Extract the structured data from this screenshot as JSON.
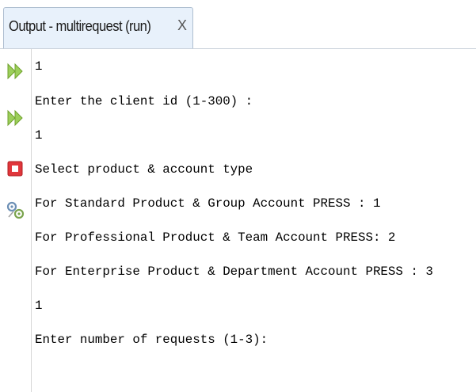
{
  "tab": {
    "title": "Output - multirequest (run)",
    "close_label": "X"
  },
  "gutter": {
    "icons": [
      "rerun-icon",
      "rerun-with-options-icon",
      "stop-icon",
      "settings-icon"
    ]
  },
  "colors": {
    "rerun_green": "#8bc53f",
    "stop_red": "#e0363b",
    "tab_bg": "#e8f1fb"
  },
  "console": {
    "lines": [
      "1",
      "Enter the client id (1-300) :",
      "1",
      "Select product & account type",
      "For Standard Product & Group Account PRESS : 1",
      "For Professional Product & Team Account PRESS: 2",
      "For Enterprise Product & Department Account PRESS : 3",
      "1",
      "Enter number of requests (1-3):"
    ]
  }
}
